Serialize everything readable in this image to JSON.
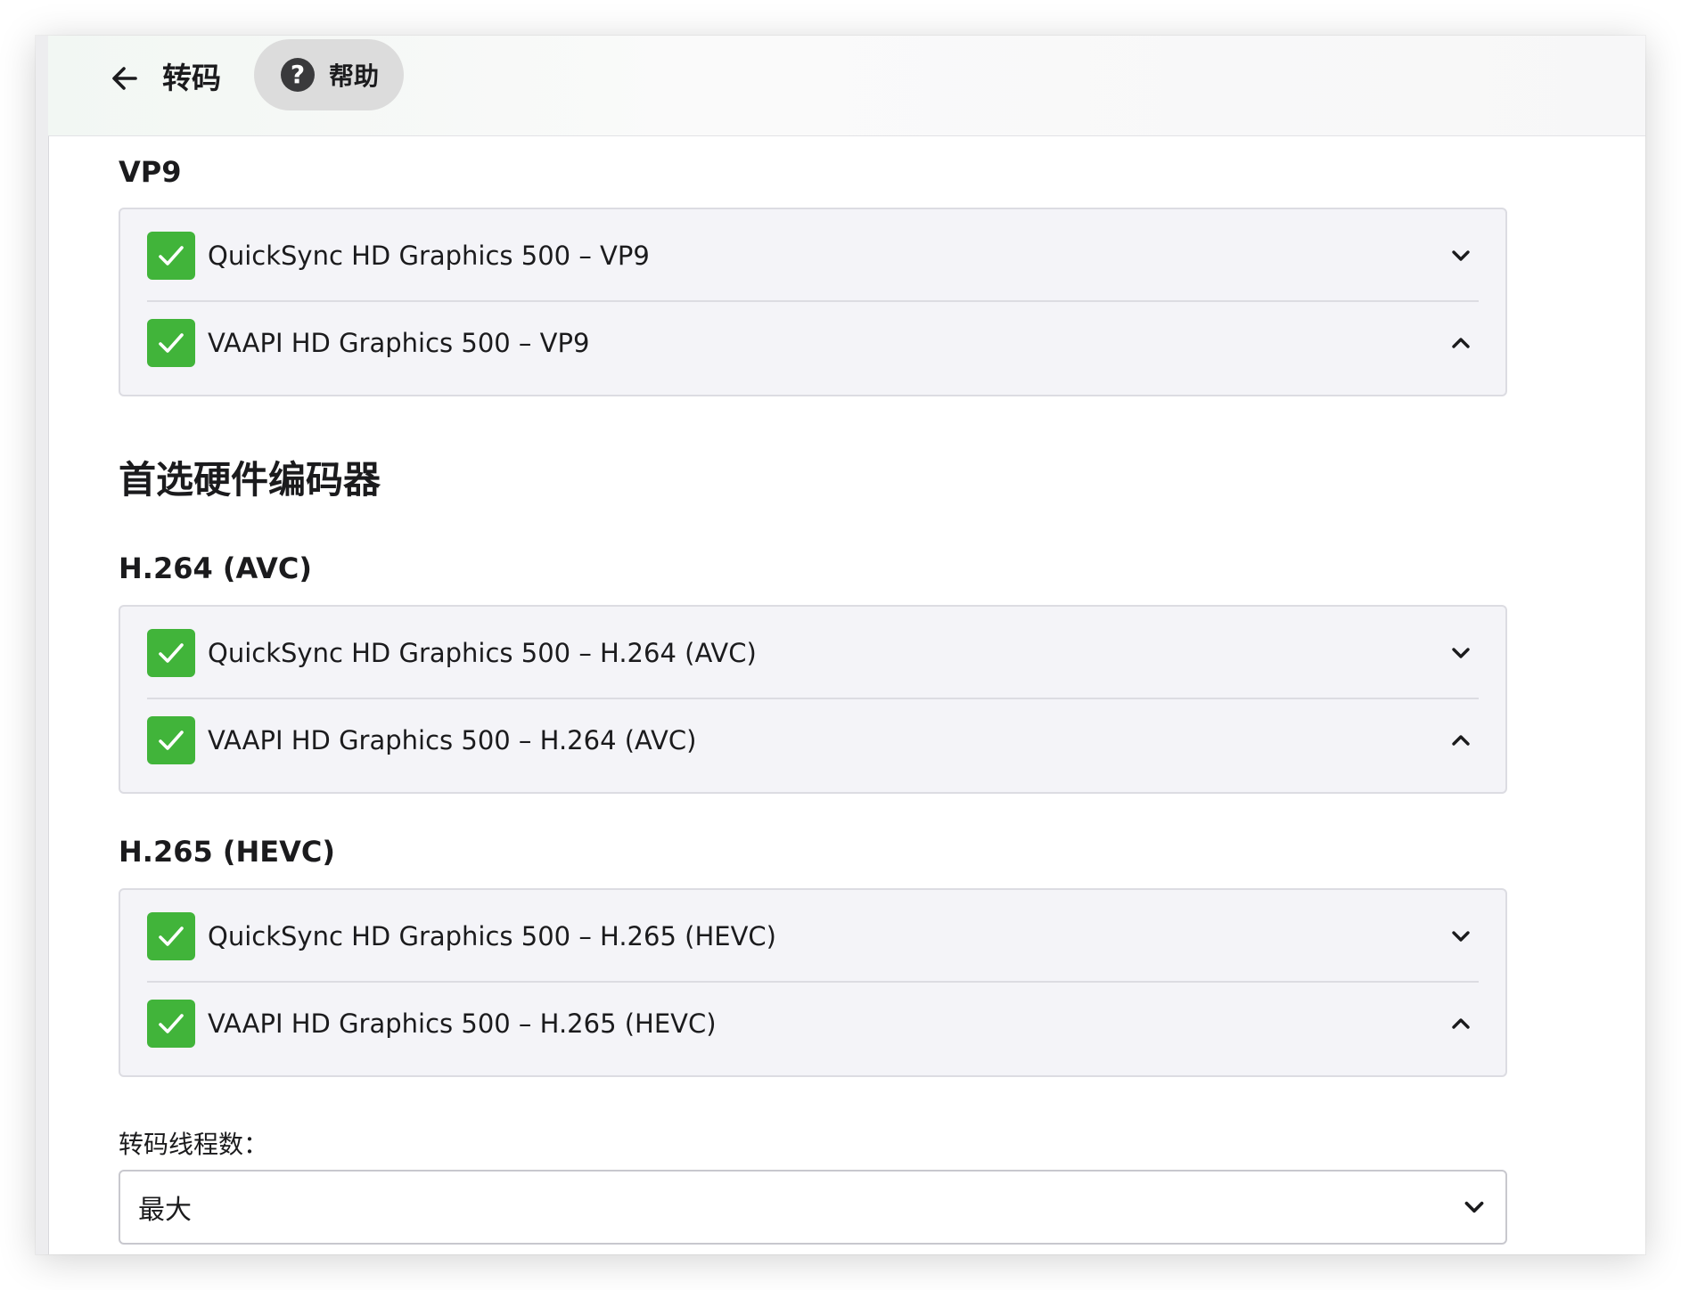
{
  "header": {
    "back_icon": "arrow-left-icon",
    "title": "转码",
    "help": {
      "icon": "question-circle-icon",
      "label": "帮助"
    }
  },
  "vp9_group": {
    "label": "VP9",
    "items": [
      {
        "label": "QuickSync HD Graphics 500 – VP9",
        "checked": true,
        "chevron": "chevron-down-icon"
      },
      {
        "label": "VAAPI HD Graphics 500 – VP9",
        "checked": true,
        "chevron": "chevron-up-icon"
      }
    ]
  },
  "preferred_encoders": {
    "heading": "首选硬件编码器",
    "h264": {
      "label": "H.264 (AVC)",
      "items": [
        {
          "label": "QuickSync HD Graphics 500 – H.264 (AVC)",
          "checked": true,
          "chevron": "chevron-down-icon"
        },
        {
          "label": "VAAPI HD Graphics 500 – H.264 (AVC)",
          "checked": true,
          "chevron": "chevron-up-icon"
        }
      ]
    },
    "h265": {
      "label": "H.265 (HEVC)",
      "items": [
        {
          "label": "QuickSync HD Graphics 500 – H.265 (HEVC)",
          "checked": true,
          "chevron": "chevron-down-icon"
        },
        {
          "label": "VAAPI HD Graphics 500 – H.265 (HEVC)",
          "checked": true,
          "chevron": "chevron-up-icon"
        }
      ]
    }
  },
  "thread_count": {
    "label": "转码线程数：",
    "value": "最大",
    "icon": "chevron-down-icon"
  },
  "colors": {
    "check_green": "#41b43a",
    "panel_bg": "#f4f4f8",
    "help_bg": "#dcdcdc",
    "text": "#1b1b1d"
  }
}
